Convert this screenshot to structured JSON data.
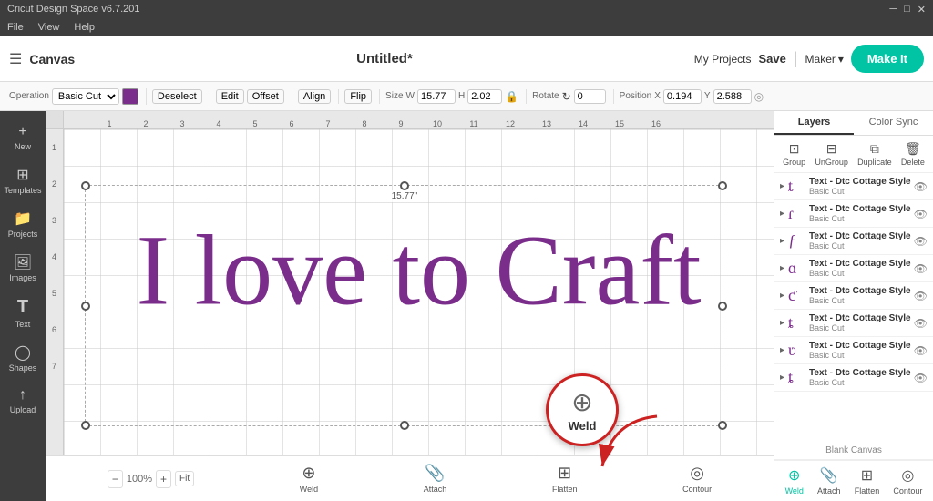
{
  "titleBar": {
    "appName": "Cricut Design Space  v6.7.201",
    "btnMin": "─",
    "btnMax": "□",
    "btnClose": "✕"
  },
  "menuBar": {
    "items": [
      "File",
      "View",
      "Help"
    ]
  },
  "topToolbar": {
    "hamburger": "☰",
    "canvasLabel": "Canvas",
    "docTitle": "Untitled*",
    "myProjects": "My Projects",
    "save": "Save",
    "divider": "|",
    "maker": "Maker",
    "makeIt": "Make It"
  },
  "secondToolbar": {
    "operationLabel": "Operation",
    "operationValue": "Basic Cut",
    "deselectLabel": "Deselect",
    "editLabel": "Edit",
    "offsetLabel": "Offset",
    "alignLabel": "Align",
    "flipLabel": "Flip",
    "sizeLabel": "Size",
    "wLabel": "W",
    "wValue": "15.77",
    "hLabel": "H",
    "hValue": "2.02",
    "rotateLabel": "Rotate",
    "rotateValue": "0",
    "positionLabel": "Position",
    "xLabel": "X",
    "xValue": "0.194",
    "yLabel": "Y",
    "yValue": "2.588"
  },
  "leftSidebar": {
    "items": [
      {
        "id": "new",
        "icon": "+",
        "label": "New"
      },
      {
        "id": "templates",
        "icon": "⊞",
        "label": "Templates"
      },
      {
        "id": "projects",
        "icon": "📁",
        "label": "Projects"
      },
      {
        "id": "images",
        "icon": "🖼",
        "label": "Images"
      },
      {
        "id": "text",
        "icon": "T",
        "label": "Text"
      },
      {
        "id": "shapes",
        "icon": "◯",
        "label": "Shapes"
      },
      {
        "id": "upload",
        "icon": "↑",
        "label": "Upload"
      }
    ]
  },
  "canvas": {
    "text": "I love to Craft",
    "dimensionLabel": "15.77\"",
    "rulerNumbers": [
      "",
      "1",
      "2",
      "3",
      "4",
      "5",
      "6",
      "7",
      "8",
      "9",
      "10",
      "11",
      "12",
      "13",
      "14",
      "15",
      "16"
    ],
    "rulerNumbersV": [
      "1",
      "2",
      "3",
      "4",
      "5",
      "6",
      "7"
    ]
  },
  "weld": {
    "label": "Weld"
  },
  "rightPanel": {
    "tabs": [
      "Layers",
      "Color Sync"
    ],
    "actions": [
      {
        "id": "group",
        "label": "Group",
        "icon": "⊡"
      },
      {
        "id": "ungroup",
        "label": "UnGroup",
        "icon": "⊟"
      },
      {
        "id": "duplicate",
        "label": "Duplicate",
        "icon": "⧉"
      },
      {
        "id": "delete",
        "label": "Delete",
        "icon": "🗑"
      }
    ],
    "layers": [
      {
        "name": "Text - Dtc Cottage Style",
        "sub": "Basic Cut",
        "icon": "ȶ",
        "expanded": true
      },
      {
        "name": "Text - Dtc Cottage Style",
        "sub": "Basic Cut",
        "icon": "ɾ",
        "expanded": true
      },
      {
        "name": "Text - Dtc Cottage Style",
        "sub": "Basic Cut",
        "icon": "ƒ",
        "expanded": true
      },
      {
        "name": "Text - Dtc Cottage Style",
        "sub": "Basic Cut",
        "icon": "ɑ",
        "expanded": true
      },
      {
        "name": "Text - Dtc Cottage Style",
        "sub": "Basic Cut",
        "icon": "ƈ",
        "expanded": true
      },
      {
        "name": "Text - Dtc Cottage Style",
        "sub": "Basic Cut",
        "icon": "ȶ",
        "expanded": true
      },
      {
        "name": "Text - Dtc Cottage Style",
        "sub": "Basic Cut",
        "icon": "ʋ",
        "expanded": true
      },
      {
        "name": "Text - Dtc Cottage Style",
        "sub": "Basic Cut",
        "icon": "ȶ",
        "expanded": true
      }
    ],
    "blankCanvas": "Blank Canvas",
    "bottomBtns": [
      {
        "id": "weld",
        "label": "Weld",
        "icon": "⊕",
        "active": true
      },
      {
        "id": "attach",
        "label": "Attach",
        "icon": "📎",
        "active": false
      },
      {
        "id": "flatten",
        "label": "Flatten",
        "icon": "⊞",
        "active": false
      },
      {
        "id": "contour",
        "label": "Contour",
        "icon": "◎",
        "active": false
      }
    ]
  }
}
